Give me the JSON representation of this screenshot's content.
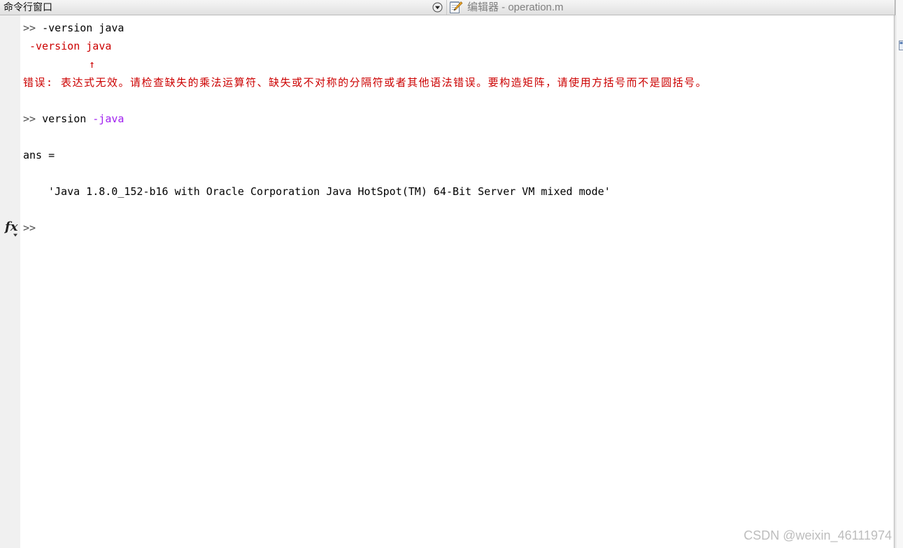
{
  "title_bar": {
    "panel_title": "命令行窗口",
    "menu_icon": "circle-down-arrow-icon",
    "editor_icon": "editor-notepad-pencil-icon",
    "editor_tab_label": "编辑器 - operation.m"
  },
  "gutter": {
    "function_browser_label": "fx",
    "function_browser_icon": "chevron-down-icon"
  },
  "right_strip": {
    "icon": "collapsed-panel-icon"
  },
  "command_window": {
    "prompt": ">>",
    "entries": [
      {
        "command": "-version java",
        "error_echo": "-version java",
        "error_caret": "↑",
        "error_message": "错误: 表达式无效。请检查缺失的乘法运算符、缺失或不对称的分隔符或者其他语法错误。要构造矩阵，请使用方括号而不是圆括号。"
      },
      {
        "command": "version",
        "argument": "-java",
        "result_name": "ans =",
        "result_value": "'Java 1.8.0_152-b16 with Oracle Corporation Java HotSpot(TM) 64-Bit Server VM mixed mode'"
      }
    ],
    "current_input": ""
  },
  "watermark": {
    "text": "CSDN @weixin_46111974"
  },
  "colors": {
    "text": "#000000",
    "prompt": "#4d4d4d",
    "error_text": "#cc0000",
    "string_literal": "#a020f0",
    "inactive_tab_text": "#808080",
    "watermark": "#bdbdbd"
  }
}
